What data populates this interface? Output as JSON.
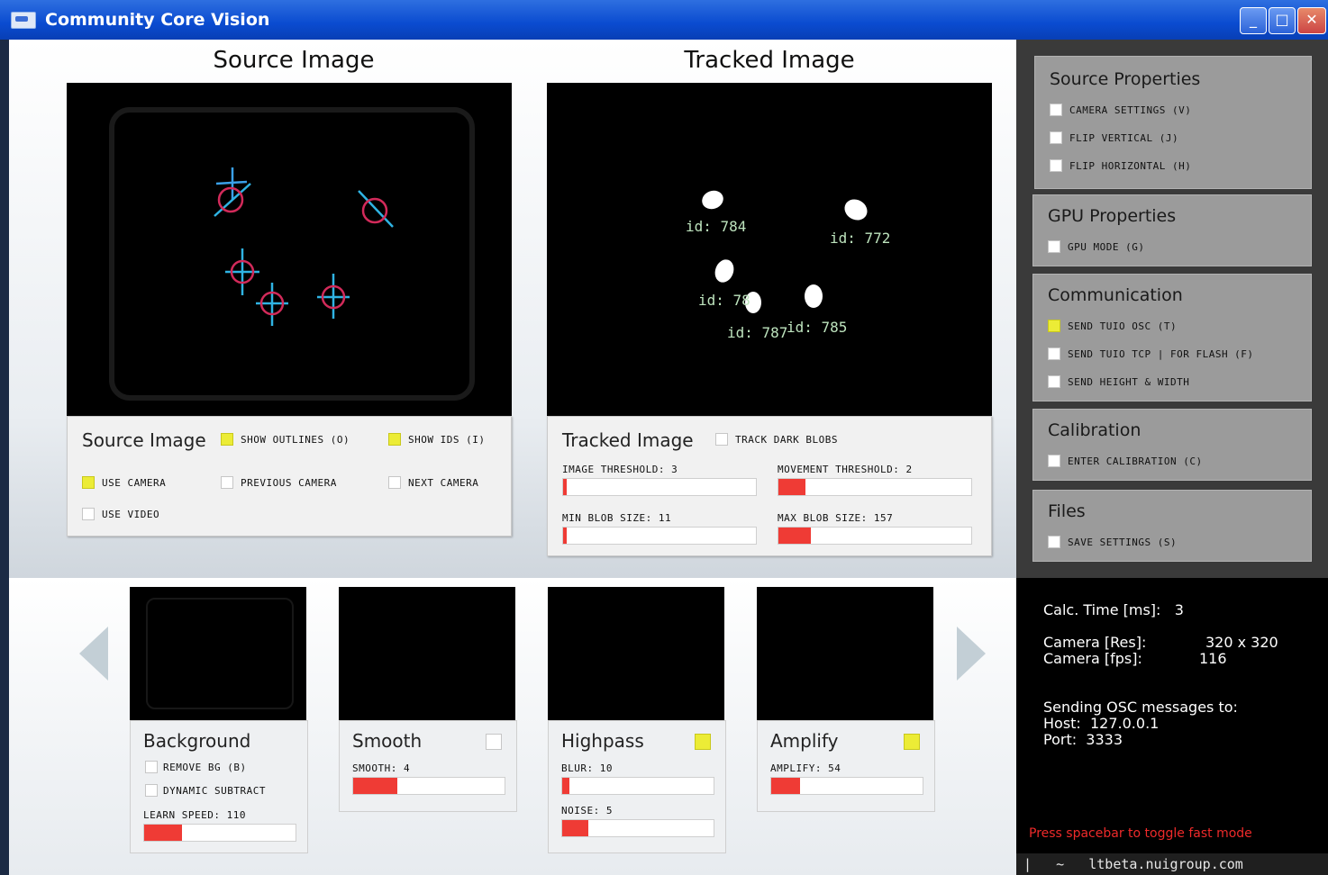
{
  "window": {
    "title": "Community Core Vision",
    "minimize": "_",
    "maximize": "□",
    "close": "✕"
  },
  "source": {
    "heading": "Source Image",
    "panel_title": "Source Image",
    "show_outlines": {
      "label": "SHOW OUTLINES (O)",
      "checked": true
    },
    "show_ids": {
      "label": "SHOW IDS (I)",
      "checked": true
    },
    "use_camera": {
      "label": "USE CAMERA",
      "checked": true
    },
    "previous_camera": {
      "label": "PREVIOUS CAMERA",
      "checked": false
    },
    "next_camera": {
      "label": "NEXT CAMERA",
      "checked": false
    },
    "use_video": {
      "label": "USE VIDEO",
      "checked": false
    }
  },
  "tracked": {
    "heading": "Tracked Image",
    "panel_title": "Tracked Image",
    "track_dark_blobs": {
      "label": "TRACK DARK BLOBS",
      "checked": false
    },
    "image_threshold": {
      "label": "IMAGE THRESHOLD: 3",
      "level": 0.02
    },
    "movement_threshold": {
      "label": "MOVEMENT THRESHOLD: 2",
      "level": 0.14
    },
    "min_blob_size": {
      "label": "MIN BLOB SIZE: 11",
      "level": 0.02
    },
    "max_blob_size": {
      "label": "MAX BLOB SIZE: 157",
      "level": 0.17
    },
    "blob_ids": [
      "id: 784",
      "id: 772",
      "id: 78",
      "id: 787",
      "id: 785"
    ]
  },
  "right": {
    "source_properties": {
      "title": "Source Properties",
      "items": [
        "CAMERA SETTINGS (V)",
        "FLIP VERTICAL (J)",
        "FLIP HORIZONTAL (H)"
      ]
    },
    "gpu_properties": {
      "title": "GPU Properties",
      "items": [
        "GPU MODE (G)"
      ]
    },
    "communication": {
      "title": "Communication",
      "items": [
        "SEND TUIO OSC (T)",
        "SEND TUIO TCP | FOR FLASH (F)",
        "SEND HEIGHT & WIDTH"
      ],
      "checked": [
        true,
        false,
        false
      ]
    },
    "calibration": {
      "title": "Calibration",
      "items": [
        "ENTER CALIBRATION (C)"
      ]
    },
    "files": {
      "title": "Files",
      "items": [
        "SAVE SETTINGS (S)"
      ]
    }
  },
  "stats": {
    "calc_time": "Calc. Time [ms]:   3",
    "camera_res": "Camera [Res]:",
    "camera_res_value": "320 x 320",
    "camera_fps": "Camera [fps]:",
    "camera_fps_value": "116",
    "sending": "Sending OSC messages to:",
    "host": "Host:  127.0.0.1",
    "port": "Port:  3333",
    "fast_mode": "Press spacebar to toggle fast mode",
    "footer": "|   ~   ltbeta.nuigroup.com"
  },
  "filters": {
    "background": {
      "name": "Background",
      "remove_bg": "REMOVE BG (B)",
      "dynamic_subtract": "DYNAMIC SUBTRACT",
      "learn_speed": "LEARN SPEED: 110",
      "learn_level": 0.25
    },
    "smooth": {
      "name": "Smooth",
      "enabled": false,
      "label": "SMOOTH: 4",
      "level": 0.29
    },
    "highpass": {
      "name": "Highpass",
      "enabled": true,
      "blur": "BLUR: 10",
      "blur_level": 0.05,
      "noise": "NOISE: 5",
      "noise_level": 0.17
    },
    "amplify": {
      "name": "Amplify",
      "enabled": true,
      "label": "AMPLIFY: 54",
      "level": 0.19
    }
  },
  "colors": {
    "checkbox_on": "#ecec36",
    "slider_fill": "#ef3b35",
    "right_panel": "#9b9b9b",
    "fast_mode_text": "#ee2a2a"
  }
}
